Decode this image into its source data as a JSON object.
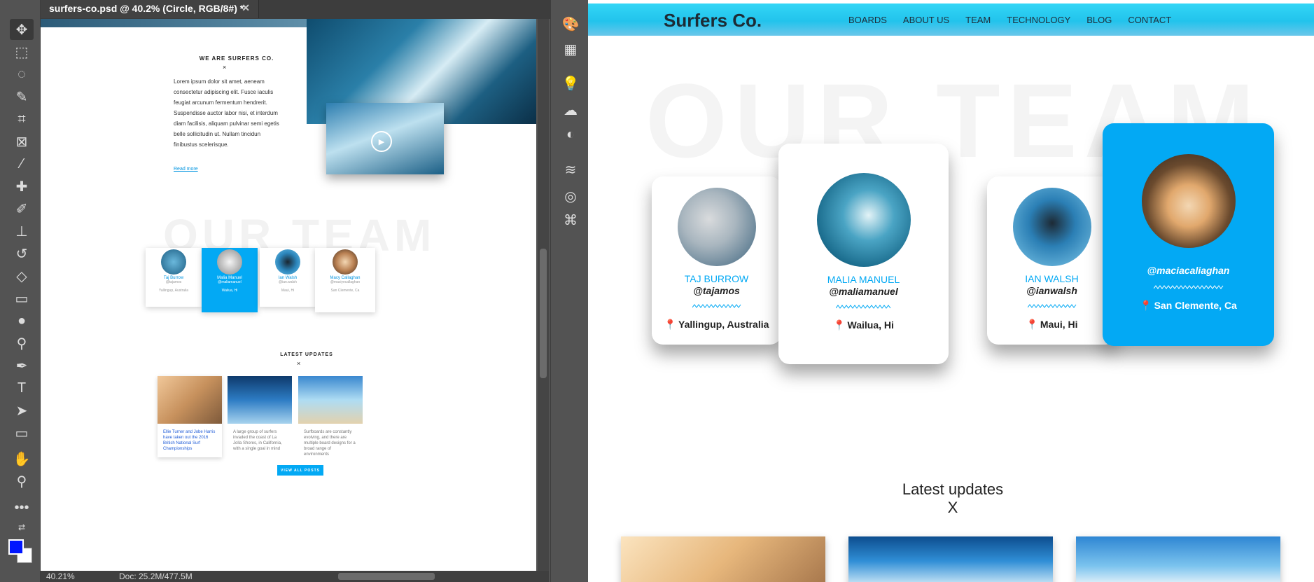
{
  "photoshop": {
    "tab_title": "surfers-co.psd @ 40.2% (Circle, RGB/8#) *",
    "tab_close": "✕",
    "zoom_level": "40.21%",
    "doc_info": "Doc: 25.2M/477.5M",
    "foreground_color": "#0015ff",
    "background_color": "#ffffff",
    "tools": [
      "move-icon",
      "marquee-icon",
      "lasso-icon",
      "quick-select-icon",
      "crop-icon",
      "frame-icon",
      "eyedropper-icon",
      "healing-icon",
      "brush-icon",
      "stamp-icon",
      "history-brush-icon",
      "eraser-icon",
      "gradient-icon",
      "blur-icon",
      "dodge-icon",
      "pen-icon",
      "type-icon",
      "path-select-icon",
      "rectangle-icon",
      "hand-icon",
      "zoom-icon",
      "more-icon"
    ],
    "panels": [
      "color-palette-icon",
      "swatches-icon",
      "learn-icon",
      "libraries-icon",
      "adjustments-icon",
      "layers-icon",
      "channels-icon",
      "paths-icon"
    ],
    "canvas": {
      "title": "WE ARE SURFERS CO.",
      "x_mark": "×",
      "paragraph": "Lorem ipsum dolor sit amet, aeneam consectetur adipiscing elit. Fusce iaculis feugiat arcunum fermentum hendrerit. Suspendisse auctor labor nisi, et interdum diam facilisis, aliquam pulvinar semi egetis belle sollicitudin ut. Nullam tincidun finibustus scelerisque.",
      "read_more": "Read more",
      "our_team_bg": "OUR TEAM",
      "team": [
        {
          "name": "Taj Burrow",
          "handle": "@tajamos",
          "location": "Yallingup, Australia"
        },
        {
          "name": "Malia Manuel",
          "handle": "@maliamanuel",
          "location": "Wailua, Hi"
        },
        {
          "name": "Ian Walsh",
          "handle": "@ian.walsh",
          "location": "Maui, Hi"
        },
        {
          "name": "Macy Callaghan",
          "handle": "@maciyecallaghan",
          "location": "San Clemente, Ca"
        }
      ],
      "latest_title": "LATEST UPDATES",
      "latest_x": "×",
      "posts": [
        "Ellie Turner and Jobe Harris have taken out the 2016 British National Surf Championships",
        "A large group of surfers invaded the coast of La Jolla Shores, in California, with a single goal in mind",
        "Surfboards are constantly evolving, and there are multiple board designs for a broad range of environments"
      ],
      "view_all": "VIEW ALL POSTS"
    }
  },
  "site": {
    "logo": "Surfers Co.",
    "nav": [
      "BOARDS",
      "ABOUT US",
      "TEAM",
      "TECHNOLOGY",
      "BLOG",
      "CONTACT"
    ],
    "our_team_bg": "OUR TEAM",
    "team": [
      {
        "name": "TAJ BURROW",
        "handle": "@tajamos",
        "location": "Yallingup, Australia"
      },
      {
        "name": "MALIA MANUEL",
        "handle": "@maliamanuel",
        "location": "Wailua, Hi"
      },
      {
        "name": "IAN WALSH",
        "handle": "@ianwalsh",
        "location": "Maui, Hi"
      },
      {
        "name": "",
        "handle": "@maciacaliaghan",
        "location": "San Clemente, Ca"
      }
    ],
    "latest_title": "Latest updates",
    "latest_x": "X",
    "accent_color": "#03a9f4"
  }
}
